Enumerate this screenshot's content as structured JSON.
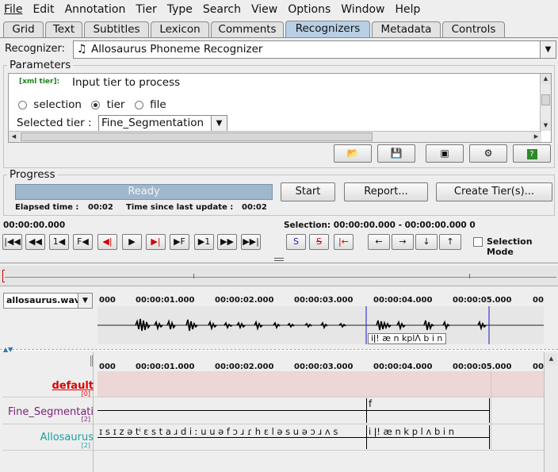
{
  "menu": [
    "File",
    "Edit",
    "Annotation",
    "Tier",
    "Type",
    "Search",
    "View",
    "Options",
    "Window",
    "Help"
  ],
  "tabs": [
    "Grid",
    "Text",
    "Subtitles",
    "Lexicon",
    "Comments",
    "Recognizers",
    "Metadata",
    "Controls"
  ],
  "active_tab": "Recognizers",
  "recognizer": {
    "label": "Recognizer:",
    "value": "Allosaurus Phoneme Recognizer"
  },
  "parameters": {
    "title": "Parameters",
    "xml_tag": "[xml tier]:",
    "description": "Input tier to process",
    "options": [
      "selection",
      "tier",
      "file"
    ],
    "selected_option": "tier",
    "selected_tier_label": "Selected tier :",
    "selected_tier_value": "Fine_Segmentation"
  },
  "progress": {
    "title": "Progress",
    "status": "Ready",
    "start": "Start",
    "report": "Report...",
    "create_tiers": "Create Tier(s)...",
    "elapsed_label": "Elapsed time :",
    "elapsed_value": "00:02",
    "since_label": "Time since last update :",
    "since_value": "00:02"
  },
  "media": {
    "current_time": "00:00:00.000",
    "selection": "Selection: 00:00:00.000 - 00:00:00.000  0",
    "selection_mode": "Selection Mode",
    "transport_buttons": [
      "|◀◀",
      "◀◀",
      "1◀",
      "F◀",
      "◀|",
      "▶",
      "▶|",
      "▶F",
      "▶1",
      "▶▶",
      "▶▶|"
    ],
    "selection_buttons": [
      "S",
      "S",
      "|←"
    ],
    "nav_buttons": [
      "←",
      "→",
      "↓",
      "↑"
    ]
  },
  "waveform": {
    "file": "allosaurus.wav",
    "ticks": [
      "000",
      "00:00:01.000",
      "00:00:02.000",
      "00:00:03.000",
      "00:00:04.000",
      "00:00:05.000",
      "00"
    ],
    "segment_label": "iǀ! æ n kplɅ b i n"
  },
  "timeline": {
    "ticks": [
      "000",
      "00:00:01.000",
      "00:00:02.000",
      "00:00:03.000",
      "00:00:04.000",
      "00:00:05.000",
      "00"
    ],
    "tiers": [
      {
        "name": "default",
        "count": "[0]",
        "color": "#dd0000"
      },
      {
        "name": "Fine_Segmentati",
        "count": "[2]",
        "color": "#7a1f7a",
        "annotation": "f"
      },
      {
        "name": "Allosaurus",
        "count": "[2]",
        "color": "#1aa0a0",
        "annotation_left": "ɪ s ɪ z ə tⁱ ɛ s t a ɹ d i ː u u ə f ɔ ɹ ɾ h ɛ l ə s u ə ɔ ɹ ʌ s",
        "annotation_right": "i ǀ! æ n k p l ʌ b i n"
      }
    ]
  },
  "colors": {
    "active_tab": "#b8cfe5",
    "progress": "#9fb6cd",
    "default_tier_bg": "#ecd6d6",
    "cursor": "#1b1bbd"
  }
}
